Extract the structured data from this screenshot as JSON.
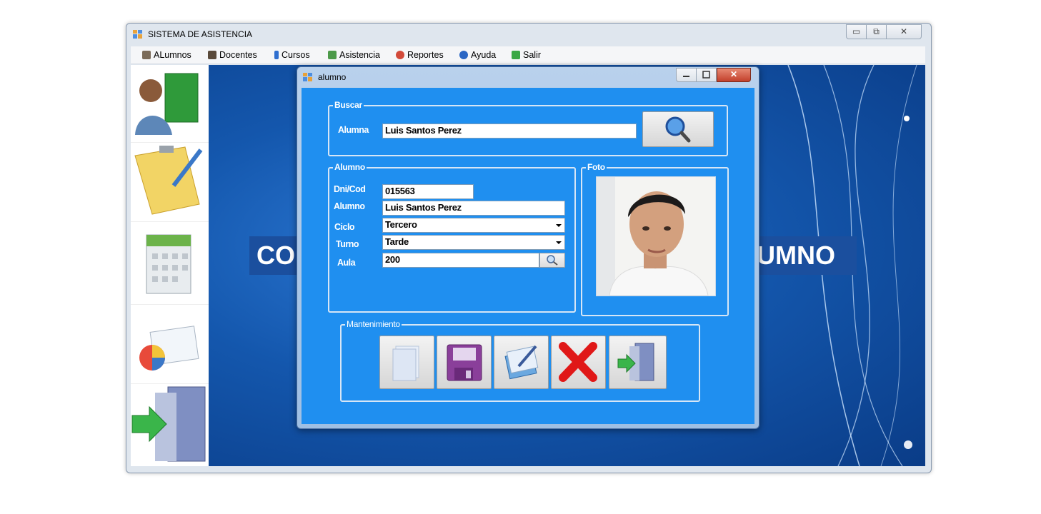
{
  "window": {
    "title": "SISTEMA DE ASISTENCIA",
    "minimize": "▭",
    "maximize": "⧉",
    "close": "✕"
  },
  "menu": {
    "items": [
      {
        "label": "ALumnos",
        "icon": "students-icon"
      },
      {
        "label": "Docentes",
        "icon": "teachers-icon"
      },
      {
        "label": "Cursos",
        "icon": "book-icon"
      },
      {
        "label": "Asistencia",
        "icon": "attendance-icon"
      },
      {
        "label": "Reportes",
        "icon": "reports-icon"
      },
      {
        "label": "Ayuda",
        "icon": "help-icon"
      },
      {
        "label": "Salir",
        "icon": "exit-icon"
      }
    ]
  },
  "background": {
    "banner_left": "CO",
    "banner_right": "UMNO"
  },
  "dialog": {
    "title": "alumno",
    "close": "✕",
    "buscar": {
      "legend": "Buscar",
      "label": "Alumna",
      "value": "Luis Santos Perez"
    },
    "alumno": {
      "legend": "Alumno",
      "dni_label": "Dni/Cod",
      "dni_value": "015563",
      "name_label": "Alumno",
      "name_value": "Luis Santos Perez",
      "ciclo_label": "Ciclo",
      "ciclo_value": "Tercero",
      "turno_label": "Turno",
      "turno_value": "Tarde",
      "aula_label": "Aula",
      "aula_value": "200"
    },
    "foto": {
      "legend": "Foto"
    },
    "mantenimiento": {
      "legend": "Mantenimiento"
    }
  },
  "colors": {
    "dialog_body": "#1f8ff0",
    "desktop": "#1a5fb4"
  }
}
